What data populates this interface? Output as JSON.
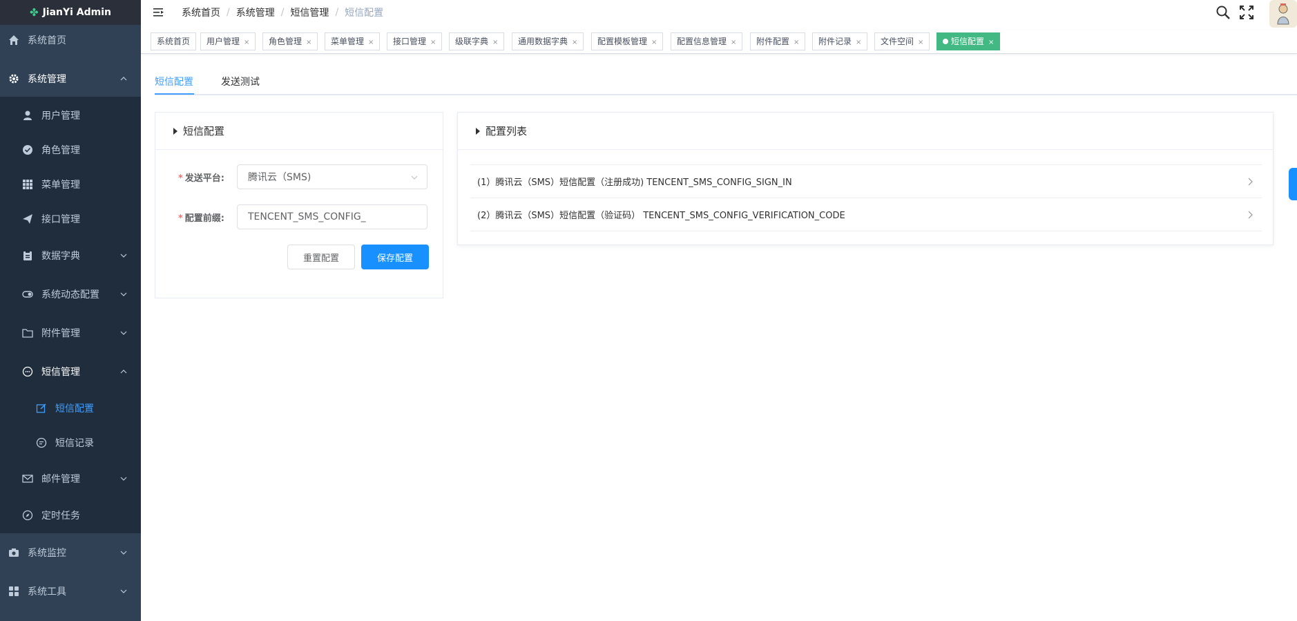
{
  "app": {
    "title": "JianYi Admin"
  },
  "sidebar": {
    "items": [
      {
        "label": "系统首页",
        "icon": "home-icon"
      },
      {
        "label": "系统管理",
        "icon": "gear-icon"
      },
      {
        "label": "用户管理",
        "icon": "user-icon"
      },
      {
        "label": "角色管理",
        "icon": "check-circle-icon"
      },
      {
        "label": "菜单管理",
        "icon": "grid-icon"
      },
      {
        "label": "接口管理",
        "icon": "paper-plane-icon"
      },
      {
        "label": "数据字典",
        "icon": "clipboard-icon"
      },
      {
        "label": "系统动态配置",
        "icon": "toggle-icon"
      },
      {
        "label": "附件管理",
        "icon": "folder-icon"
      },
      {
        "label": "短信管理",
        "icon": "chat-icon"
      },
      {
        "label": "短信配置",
        "icon": "edit-icon"
      },
      {
        "label": "短信记录",
        "icon": "message-icon"
      },
      {
        "label": "邮件管理",
        "icon": "mail-icon"
      },
      {
        "label": "定时任务",
        "icon": "compass-icon"
      },
      {
        "label": "系统监控",
        "icon": "camera-icon"
      },
      {
        "label": "系统工具",
        "icon": "apps-icon"
      }
    ]
  },
  "header": {
    "breadcrumb": [
      "系统首页",
      "系统管理",
      "短信管理",
      "短信配置"
    ],
    "separator": "/"
  },
  "tags": [
    {
      "label": "系统首页",
      "closable": false
    },
    {
      "label": "用户管理",
      "closable": true
    },
    {
      "label": "角色管理",
      "closable": true
    },
    {
      "label": "菜单管理",
      "closable": true
    },
    {
      "label": "接口管理",
      "closable": true
    },
    {
      "label": "级联字典",
      "closable": true
    },
    {
      "label": "通用数据字典",
      "closable": true
    },
    {
      "label": "配置模板管理",
      "closable": true
    },
    {
      "label": "配置信息管理",
      "closable": true
    },
    {
      "label": "附件配置",
      "closable": true
    },
    {
      "label": "附件记录",
      "closable": true
    },
    {
      "label": "文件空间",
      "closable": true
    },
    {
      "label": "短信配置",
      "closable": true,
      "active": true
    }
  ],
  "close_glyph": "×",
  "content_tabs": [
    "短信配置",
    "发送测试"
  ],
  "config_card": {
    "title": "短信配置",
    "platform_label": "发送平台:",
    "platform_value": "腾讯云（SMS)",
    "prefix_label": "配置前缀:",
    "prefix_value": "TENCENT_SMS_CONFIG_",
    "required_mark": "*",
    "reset_button": "重置配置",
    "save_button": "保存配置"
  },
  "list_card": {
    "title": "配置列表",
    "items": [
      "(1）腾讯云（SMS）短信配置（注册成功) TENCENT_SMS_CONFIG_SIGN_IN",
      "(2）腾讯云（SMS）短信配置（验证码） TENCENT_SMS_CONFIG_VERIFICATION_CODE"
    ]
  },
  "colors": {
    "sidebar_bg": "#304156",
    "submenu_bg": "#1f2d3d",
    "accent": "#409eff",
    "primary_button": "#1890ff",
    "active_tag": "#42b983"
  }
}
